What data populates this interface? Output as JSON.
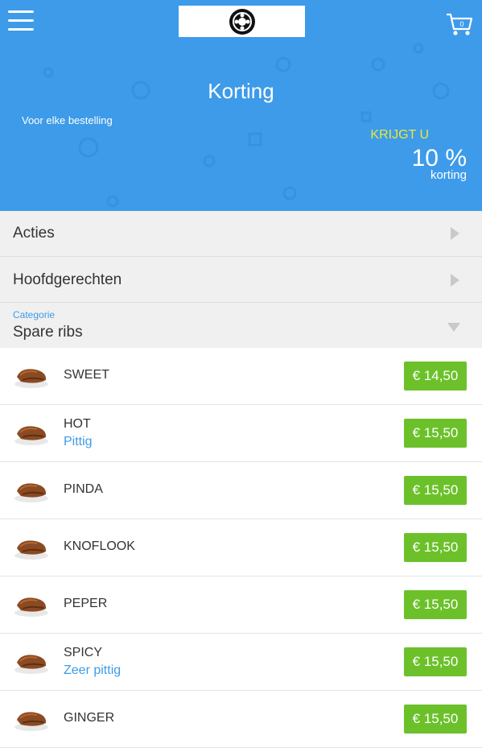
{
  "header": {
    "menu_icon": "hamburger-icon",
    "logo_icon": "restaurant-logo",
    "cart_icon": "cart-icon",
    "cart_count": "0"
  },
  "hero": {
    "title": "Korting",
    "subtitle": "Voor elke bestelling",
    "krijgt": "KRIJGT U",
    "percent": "10 %",
    "percent_label": "korting",
    "background": "#3d9be9",
    "accent": "#e8e83a"
  },
  "nav": {
    "acties": "Acties",
    "hoofdgerechten": "Hoofdgerechten",
    "category_label": "Categorie",
    "category_value": "Spare ribs"
  },
  "items": [
    {
      "name": "SWEET",
      "sub": "",
      "price": "€ 14,50"
    },
    {
      "name": "HOT",
      "sub": "Pittig",
      "price": "€ 15,50"
    },
    {
      "name": "PINDA",
      "sub": "",
      "price": "€ 15,50"
    },
    {
      "name": "KNOFLOOK",
      "sub": "",
      "price": "€ 15,50"
    },
    {
      "name": "PEPER",
      "sub": "",
      "price": "€ 15,50"
    },
    {
      "name": "SPICY",
      "sub": "Zeer pittig",
      "price": "€ 15,50"
    },
    {
      "name": "GINGER",
      "sub": "",
      "price": "€ 15,50"
    }
  ],
  "colors": {
    "price_bg": "#6cc12b",
    "link": "#3d9be9"
  }
}
